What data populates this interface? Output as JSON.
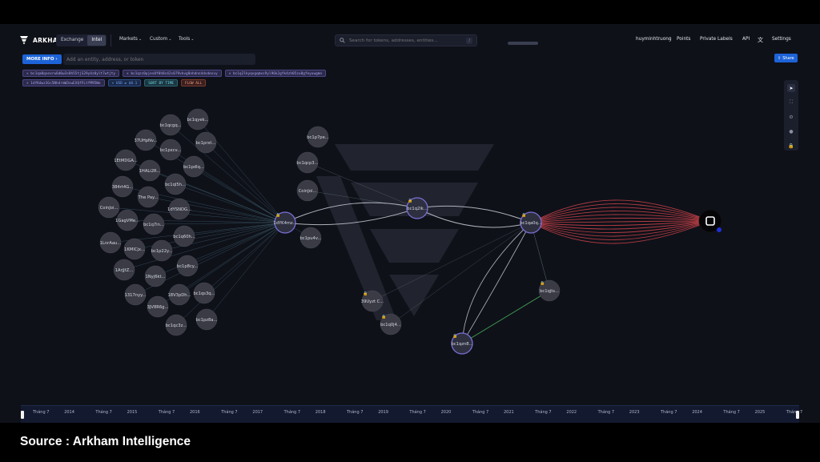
{
  "header": {
    "brand": "ARKHAM",
    "segments": [
      "Exchange",
      "Intel"
    ],
    "active_segment": "Intel",
    "menus": [
      "Markets",
      "Custom",
      "Tools"
    ],
    "search_placeholder": "Search for tokens, addresses, entities...",
    "search_shortcut": "/",
    "right_nav": [
      "huyminhtruong",
      "Points",
      "Private Labels",
      "API",
      "Settings"
    ]
  },
  "toolbar": {
    "more_info": "MORE INFO ›",
    "entity_placeholder": "Add an entity, address, or token",
    "share": "Share"
  },
  "filters": {
    "row1": [
      {
        "text": "× bc1qa0qvexrw6d0w3s8h55tjS29y4z0ylt7wtjty",
        "kind": "addr"
      },
      {
        "text": "× bc1qzc0pjes0f0h8s42s079vkvg8nhdnn4dvdexvy",
        "kind": "addr"
      },
      {
        "text": "× bc1q2lkyqvgqmxs9yl96k2gfk4zh05zu0gfeyuwgmn",
        "kind": "addr"
      }
    ],
    "row2": [
      {
        "text": "× 1dYKdwz3Gc5Nh4rmW3swEXQfFLtfM95We",
        "kind": "addr"
      },
      {
        "text": "× USD ≥ $0.1",
        "kind": "usd"
      },
      {
        "text": "SORT BY TIME",
        "kind": "sort"
      },
      {
        "text": "FLOW ALL",
        "kind": "flow"
      }
    ]
  },
  "graph": {
    "nodes": [
      {
        "id": "hub_left",
        "label": "1dYK4mz..."
      },
      {
        "id": "hub_mid",
        "label": "bc1q2lk..."
      },
      {
        "id": "hub_right",
        "label": "bc1qa0q..."
      },
      {
        "id": "hub_bottom",
        "label": "bc1qzn8..."
      },
      {
        "id": "exchange",
        "label": ""
      },
      {
        "id": "n1",
        "label": "bc1qyek..."
      },
      {
        "id": "n2",
        "label": "bc1qcgq..."
      },
      {
        "id": "n3",
        "label": "37UHpNv..."
      },
      {
        "id": "n4",
        "label": "bc1prxt..."
      },
      {
        "id": "n5",
        "label": "bc1pxcv..."
      },
      {
        "id": "n6",
        "label": "1EtMDGA..."
      },
      {
        "id": "n7",
        "label": "bc1pdlq..."
      },
      {
        "id": "n8",
        "label": "1HALi2R..."
      },
      {
        "id": "n9",
        "label": "384rt4G..."
      },
      {
        "id": "n10",
        "label": "bc1ql5h..."
      },
      {
        "id": "n11",
        "label": "The Pay..."
      },
      {
        "id": "n12",
        "label": "1dYSNDG..."
      },
      {
        "id": "n13",
        "label": "CoinJoi..."
      },
      {
        "id": "n14",
        "label": "1GagVMe..."
      },
      {
        "id": "n15",
        "label": "bc1q7in..."
      },
      {
        "id": "n16",
        "label": "bc1q60h..."
      },
      {
        "id": "n17",
        "label": "1LnrAau..."
      },
      {
        "id": "n18",
        "label": "1KMlCjx..."
      },
      {
        "id": "n19",
        "label": "bc1p22y..."
      },
      {
        "id": "n20",
        "label": "1ArjJtZ..."
      },
      {
        "id": "n21",
        "label": "bc1p8cy..."
      },
      {
        "id": "n22",
        "label": "1Nyj6kt..."
      },
      {
        "id": "n23",
        "label": "1317nyy..."
      },
      {
        "id": "n24",
        "label": "18V3pDh..."
      },
      {
        "id": "n25",
        "label": "bc1qs3q..."
      },
      {
        "id": "n26",
        "label": "3JV8R6g..."
      },
      {
        "id": "n27",
        "label": "bc1pz8a..."
      },
      {
        "id": "n28",
        "label": "bc1qc3z..."
      },
      {
        "id": "m1",
        "label": "bc1p7pe..."
      },
      {
        "id": "m2",
        "label": "bc1qcp3..."
      },
      {
        "id": "m3",
        "label": "CoinJoi..."
      },
      {
        "id": "m4",
        "label": "bc1pu4v..."
      },
      {
        "id": "b1",
        "label": "39Uyzt C..."
      },
      {
        "id": "b2",
        "label": "bc1q0j4..."
      },
      {
        "id": "b3",
        "label": "bc1qjts..."
      }
    ]
  },
  "timeline": {
    "labels": [
      "Tháng 7",
      "2014",
      "Tháng 7",
      "2015",
      "Tháng 7",
      "2016",
      "Tháng 7",
      "2017",
      "Tháng 7",
      "2018",
      "Tháng 7",
      "2019",
      "Tháng 7",
      "2020",
      "Tháng 7",
      "2021",
      "Tháng 7",
      "2022",
      "Tháng 7",
      "2023",
      "Tháng 7",
      "2024",
      "Tháng 7",
      "2025",
      "Tháng 7"
    ]
  },
  "caption": "Source : Arkham Intelligence",
  "colors": {
    "background": "#0f1119",
    "accent": "#1d63d8",
    "hub_stroke": "#7a6fd6",
    "outflow": "#d0434a",
    "green_edge": "#48b35a"
  },
  "icons": [
    "arkham-logo-icon",
    "search-icon",
    "translate-icon",
    "share-icon",
    "pointer-icon",
    "fullscreen-icon",
    "settings-icon",
    "circle-icon",
    "lock-icon"
  ]
}
